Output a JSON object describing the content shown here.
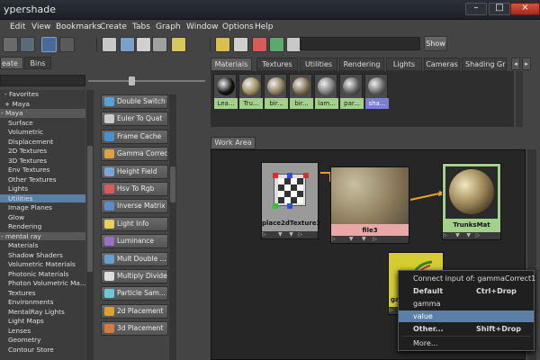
{
  "window": {
    "title": "ypershade",
    "minimize_label": "–",
    "maximize_label": "□",
    "close_label": "×"
  },
  "menu": [
    "Edit",
    "View",
    "Bookmarks",
    "Create",
    "Tabs",
    "Graph",
    "Window",
    "Options",
    "Help"
  ],
  "toolbar": {
    "show_label": "Show"
  },
  "left_tabs": [
    "eate",
    "Bins"
  ],
  "tree": [
    {
      "label": "Favorites",
      "indent": 1,
      "prefix": "-",
      "head": false
    },
    {
      "label": "Maya",
      "indent": 1,
      "prefix": "+",
      "head": false
    },
    {
      "label": "Maya",
      "indent": 0,
      "prefix": "-",
      "head": true
    },
    {
      "label": "Surface",
      "indent": 2,
      "prefix": "",
      "head": false
    },
    {
      "label": "Volumetric",
      "indent": 2,
      "prefix": "",
      "head": false
    },
    {
      "label": "Displacement",
      "indent": 2,
      "prefix": "",
      "head": false
    },
    {
      "label": "2D Textures",
      "indent": 2,
      "prefix": "",
      "head": false
    },
    {
      "label": "3D Textures",
      "indent": 2,
      "prefix": "",
      "head": false
    },
    {
      "label": "Env Textures",
      "indent": 2,
      "prefix": "",
      "head": false
    },
    {
      "label": "Other Textures",
      "indent": 2,
      "prefix": "",
      "head": false
    },
    {
      "label": "Lights",
      "indent": 2,
      "prefix": "",
      "head": false
    },
    {
      "label": "Utilities",
      "indent": 2,
      "prefix": "",
      "head": false,
      "selected": true
    },
    {
      "label": "Image Planes",
      "indent": 2,
      "prefix": "",
      "head": false
    },
    {
      "label": "Glow",
      "indent": 2,
      "prefix": "",
      "head": false
    },
    {
      "label": "Rendering",
      "indent": 2,
      "prefix": "",
      "head": false
    },
    {
      "label": "mental ray",
      "indent": 0,
      "prefix": "-",
      "head": true
    },
    {
      "label": "Materials",
      "indent": 2,
      "prefix": "",
      "head": false
    },
    {
      "label": "Shadow Shaders",
      "indent": 2,
      "prefix": "",
      "head": false
    },
    {
      "label": "Volumetric Materials",
      "indent": 2,
      "prefix": "",
      "head": false
    },
    {
      "label": "Photonic Materials",
      "indent": 2,
      "prefix": "",
      "head": false
    },
    {
      "label": "Photon Volumetric Ma...",
      "indent": 2,
      "prefix": "",
      "head": false
    },
    {
      "label": "Textures",
      "indent": 2,
      "prefix": "",
      "head": false
    },
    {
      "label": "Environments",
      "indent": 2,
      "prefix": "",
      "head": false
    },
    {
      "label": "MentalRay Lights",
      "indent": 2,
      "prefix": "",
      "head": false
    },
    {
      "label": "Light Maps",
      "indent": 2,
      "prefix": "",
      "head": false
    },
    {
      "label": "Lenses",
      "indent": 2,
      "prefix": "",
      "head": false
    },
    {
      "label": "Geometry",
      "indent": 2,
      "prefix": "",
      "head": false
    },
    {
      "label": "Contour Store",
      "indent": 2,
      "prefix": "",
      "head": false
    }
  ],
  "nodes": [
    {
      "label": "Double Switch",
      "icon_color": "#5aa0d8"
    },
    {
      "label": "Euler To Quat",
      "icon_color": "#cccccc"
    },
    {
      "label": "Frame Cache",
      "icon_color": "#4a8fd0"
    },
    {
      "label": "Gamma Correct",
      "icon_color": "#e0a040"
    },
    {
      "label": "Height Field",
      "icon_color": "#7aa6d6"
    },
    {
      "label": "Hsv To Rgb",
      "icon_color": "#d85a5a"
    },
    {
      "label": "Inverse Matrix",
      "icon_color": "#5c8bc8"
    },
    {
      "label": "Light Info",
      "icon_color": "#e6d25a"
    },
    {
      "label": "Luminance",
      "icon_color": "#9a6fc8"
    },
    {
      "label": "Mult Double ...",
      "icon_color": "#6aa0d0"
    },
    {
      "label": "Multiply Divide",
      "icon_color": "#dddddd"
    },
    {
      "label": "Particle Sam...",
      "icon_color": "#6ac8d8"
    },
    {
      "label": "2d Placement",
      "icon_color": "#e0a030"
    },
    {
      "label": "3d Placement",
      "icon_color": "#d87a40"
    }
  ],
  "top_tabs": [
    "Materials",
    "Textures",
    "Utilities",
    "Rendering",
    "Lights",
    "Cameras",
    "Shading Gr"
  ],
  "materials": [
    {
      "label": "Lea...",
      "color": "#111111",
      "blue": false
    },
    {
      "label": "Tru...",
      "color": "#9a8a5a",
      "blue": false
    },
    {
      "label": "bir...",
      "color": "#8a7a5a",
      "blue": false
    },
    {
      "label": "bir...",
      "color": "#7a6a4a",
      "blue": false
    },
    {
      "label": "lam...",
      "color": "#7a7a7a",
      "blue": false
    },
    {
      "label": "par...",
      "color": "#5a5a5a",
      "blue": false
    },
    {
      "label": "sha...",
      "color": "#666666",
      "blue": true
    }
  ],
  "work_area": {
    "tab_label": "Work Area",
    "node_place2d": "place2dTexture2",
    "node_file": "file3",
    "node_trunks": "TrunksMat",
    "node_gamma_prefix": "ga"
  },
  "context_menu": {
    "header": "Connect input of: gammaCorrect1",
    "default": "Default",
    "default_shortcut": "Ctrl+Drop",
    "gamma": "gamma",
    "value": "value",
    "other": "Other...",
    "other_shortcut": "Shift+Drop",
    "more": "More..."
  }
}
